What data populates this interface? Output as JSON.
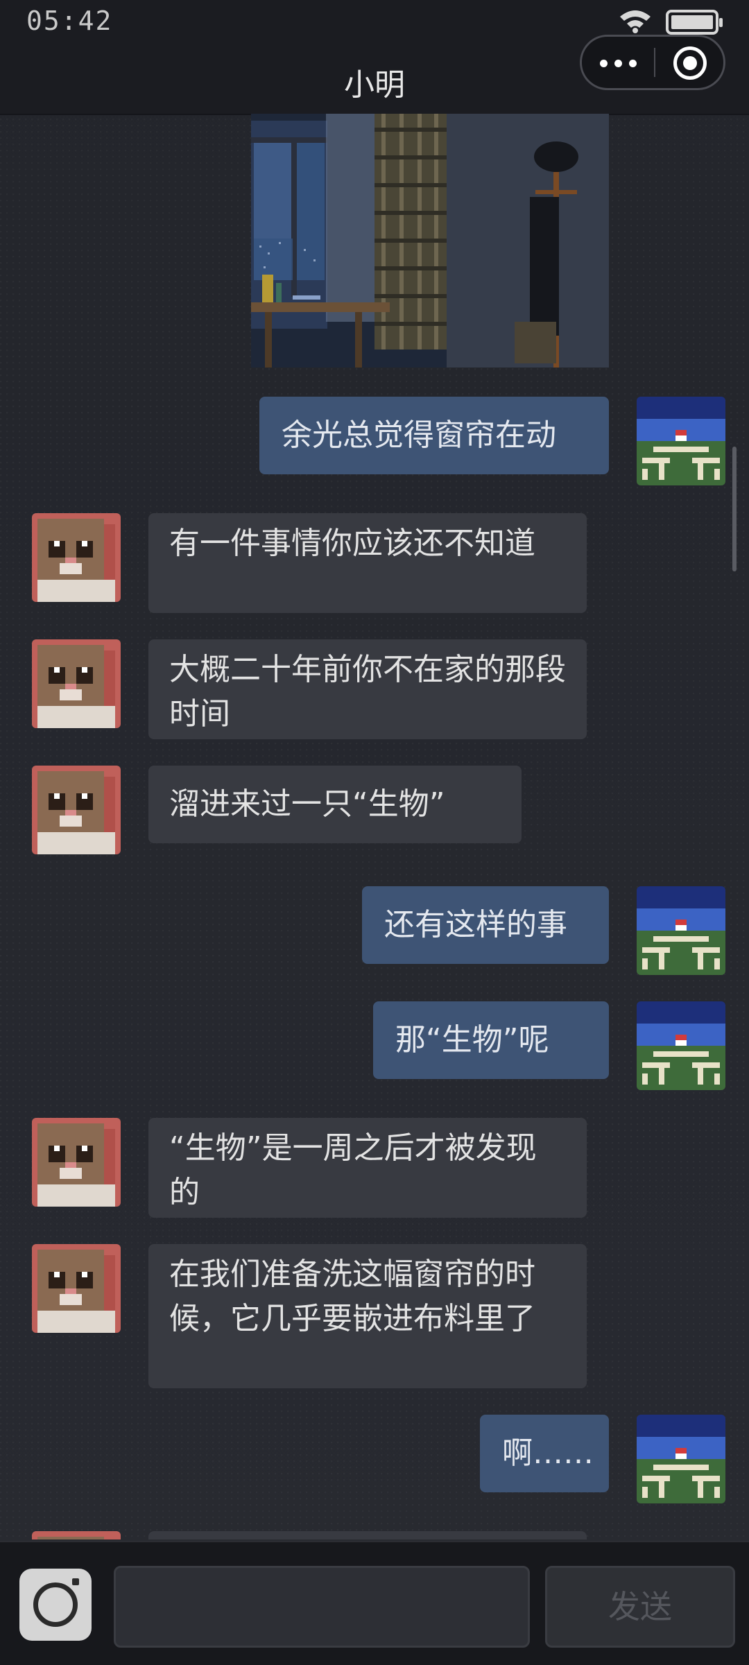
{
  "status_bar": {
    "time": "05:42",
    "wifi_icon": "wifi-icon",
    "battery_icon": "battery-icon",
    "battery_level": 1.0
  },
  "header": {
    "title": "小明",
    "more_icon": "more-icon",
    "close_icon": "target-close-icon"
  },
  "messages": [
    {
      "side": "out",
      "text": "余光总觉得窗帘在动"
    },
    {
      "side": "in",
      "text": "有一件事情你应该还不知道"
    },
    {
      "side": "in",
      "text": "大概二十年前你不在家的那段时间"
    },
    {
      "side": "in",
      "text": "溜进来过一只“生物”"
    },
    {
      "side": "out",
      "text": "还有这样的事"
    },
    {
      "side": "out",
      "text": "那“生物”呢"
    },
    {
      "side": "in",
      "text": "“生物”是一周之后才被发现的"
    },
    {
      "side": "in",
      "text": "在我们准备洗这幅窗帘的时候，它几乎要嵌进布料里了"
    },
    {
      "side": "out",
      "text": "啊……"
    }
  ],
  "input_bar": {
    "camera_icon": "camera-icon",
    "input_value": "",
    "send_label": "发送"
  },
  "colors": {
    "outgoing_bubble": "#3e5475",
    "incoming_bubble": "#383a41",
    "background": "#24262c"
  }
}
